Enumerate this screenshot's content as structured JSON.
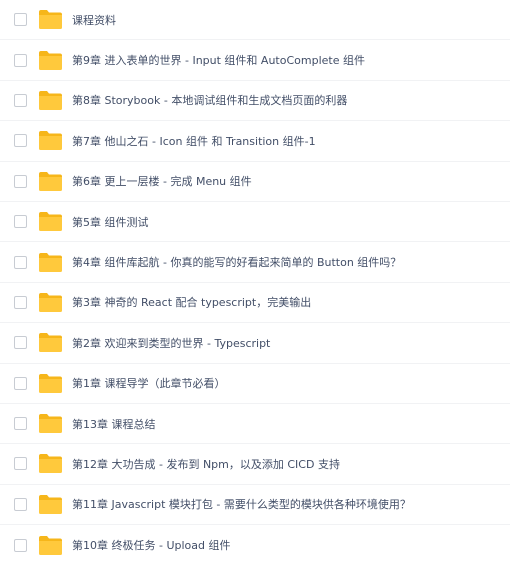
{
  "file_list": {
    "items": [
      {
        "name": "课程资料",
        "icon": "folder-icon"
      },
      {
        "name": "第9章 进入表单的世界 - Input 组件和 AutoComplete 组件",
        "icon": "folder-icon"
      },
      {
        "name": "第8章 Storybook - 本地调试组件和生成文档页面的利器",
        "icon": "folder-icon"
      },
      {
        "name": "第7章 他山之石 - Icon 组件 和 Transition 组件-1",
        "icon": "folder-icon"
      },
      {
        "name": "第6章 更上一层楼 - 完成 Menu 组件",
        "icon": "folder-icon"
      },
      {
        "name": "第5章 组件测试",
        "icon": "folder-icon"
      },
      {
        "name": "第4章 组件库起航 - 你真的能写的好看起来简单的 Button 组件吗？",
        "icon": "folder-icon"
      },
      {
        "name": "第3章 神奇的 React 配合 typescript，完美输出",
        "icon": "folder-icon"
      },
      {
        "name": "第2章 欢迎来到类型的世界 - Typescript",
        "icon": "folder-icon"
      },
      {
        "name": "第1章 课程导学（此章节必看）",
        "icon": "folder-icon"
      },
      {
        "name": "第13章 课程总结",
        "icon": "folder-icon"
      },
      {
        "name": "第12章 大功告成 - 发布到 Npm，以及添加 CICD 支持",
        "icon": "folder-icon"
      },
      {
        "name": "第11章 Javascript 模块打包 - 需要什么类型的模块供各种环境使用？",
        "icon": "folder-icon"
      },
      {
        "name": "第10章 终极任务 - Upload 组件",
        "icon": "folder-icon"
      }
    ]
  },
  "colors": {
    "folder": "#ffc93c",
    "folder_tab": "#f6b61a",
    "text": "#424e67",
    "checkbox_border": "#c8ccd3",
    "divider": "#f1f2f4"
  }
}
